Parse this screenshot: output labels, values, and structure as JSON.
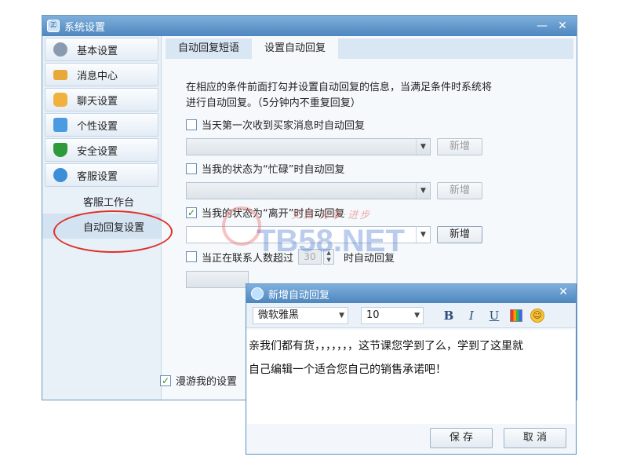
{
  "window": {
    "title": "系统设置",
    "app_icon": "㊣",
    "min_glyph": "—",
    "close_glyph": "✕"
  },
  "sidebar": {
    "items": [
      {
        "label": "基本设置",
        "icon": "gear-icon",
        "color": "#8a9bb0"
      },
      {
        "label": "消息中心",
        "icon": "envelope-icon",
        "color": "#e8a93a"
      },
      {
        "label": "聊天设置",
        "icon": "chat-bubble-icon",
        "color": "#f0b23c"
      },
      {
        "label": "个性设置",
        "icon": "personalize-icon",
        "color": "#4b9be0"
      },
      {
        "label": "安全设置",
        "icon": "shield-icon",
        "color": "#2f9a3a"
      },
      {
        "label": "客服设置",
        "icon": "customer-service-icon",
        "color": "#3c8fd6"
      }
    ],
    "subitems": [
      {
        "label": "客服工作台"
      },
      {
        "label": "自动回复设置"
      }
    ]
  },
  "tabs": [
    {
      "label": "自动回复短语"
    },
    {
      "label": "设置自动回复"
    }
  ],
  "content": {
    "desc_line1": "在相应的条件前面打勾并设置自动回复的信息，当满足条件时系统将",
    "desc_line2": "进行自动回复。（5分钟内不重复回复）",
    "options": [
      {
        "label": "当天第一次收到买家消息时自动回复",
        "checked": false,
        "button": "新增"
      },
      {
        "label": "当我的状态为“忙碌”时自动回复",
        "checked": false,
        "button": "新增"
      },
      {
        "label": "当我的状态为“离开”时自动回复",
        "checked": true,
        "button": "新增"
      }
    ],
    "contacts_prefix": "当正在联系人数超过",
    "contacts_value": "30",
    "contacts_suffix": "时自动回复"
  },
  "roaming": {
    "label": "漫游我的设置",
    "checked": true
  },
  "watermark": {
    "text": "TB58.NET",
    "slogan": "交流·分享·进步"
  },
  "popup": {
    "title": "新增自动回复",
    "close_glyph": "✕",
    "font_name": "微软雅黑",
    "font_size": "10",
    "bold": "B",
    "italic": "I",
    "underline": "U",
    "emoji_glyph": "☺",
    "editor_line1": "亲我们都有货，，，，，，，这节课您学到了么，学到了这里就",
    "editor_line2": "自己编辑一个适合您自己的销售承诺吧！",
    "save_label": "保 存",
    "cancel_label": "取 消"
  },
  "glyphs": {
    "check": "✓",
    "dropdown": "▼",
    "spin_up": "▲",
    "spin_down": "▼"
  }
}
